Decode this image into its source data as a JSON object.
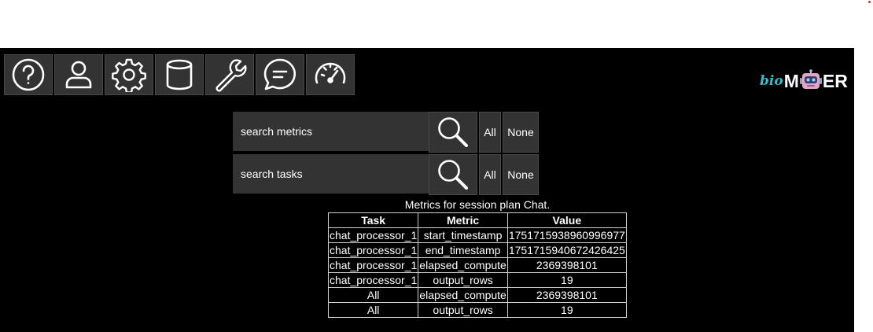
{
  "toolbar": {
    "buttons": [
      {
        "icon": "help-icon"
      },
      {
        "icon": "user-icon"
      },
      {
        "icon": "gear-icon"
      },
      {
        "icon": "database-icon"
      },
      {
        "icon": "wrench-icon"
      },
      {
        "icon": "chat-icon"
      },
      {
        "icon": "speedometer-icon"
      }
    ]
  },
  "logo": {
    "prefix": "bio",
    "left": "M",
    "right": "ER",
    "icon": "robot-icon",
    "accent": "#40b8c8"
  },
  "metric_search": {
    "placeholder": "search metrics",
    "all_label": "All",
    "none_label": "None"
  },
  "task_search": {
    "placeholder": "search tasks",
    "all_label": "All",
    "none_label": "None"
  },
  "table": {
    "caption": "Metrics for session plan Chat.",
    "headers": [
      "Task",
      "Metric",
      "Value"
    ],
    "rows": [
      [
        "chat_processor_1",
        "start_timestamp",
        "1751715938960996977"
      ],
      [
        "chat_processor_1",
        "end_timestamp",
        "1751715940672426425"
      ],
      [
        "chat_processor_1",
        "elapsed_compute",
        "2369398101"
      ],
      [
        "chat_processor_1",
        "output_rows",
        "19"
      ],
      [
        "All",
        "elapsed_compute",
        "2369398101"
      ],
      [
        "All",
        "output_rows",
        "19"
      ]
    ]
  },
  "colors": {
    "background": "#000000",
    "button": "#333333",
    "text": "#ffffff"
  }
}
